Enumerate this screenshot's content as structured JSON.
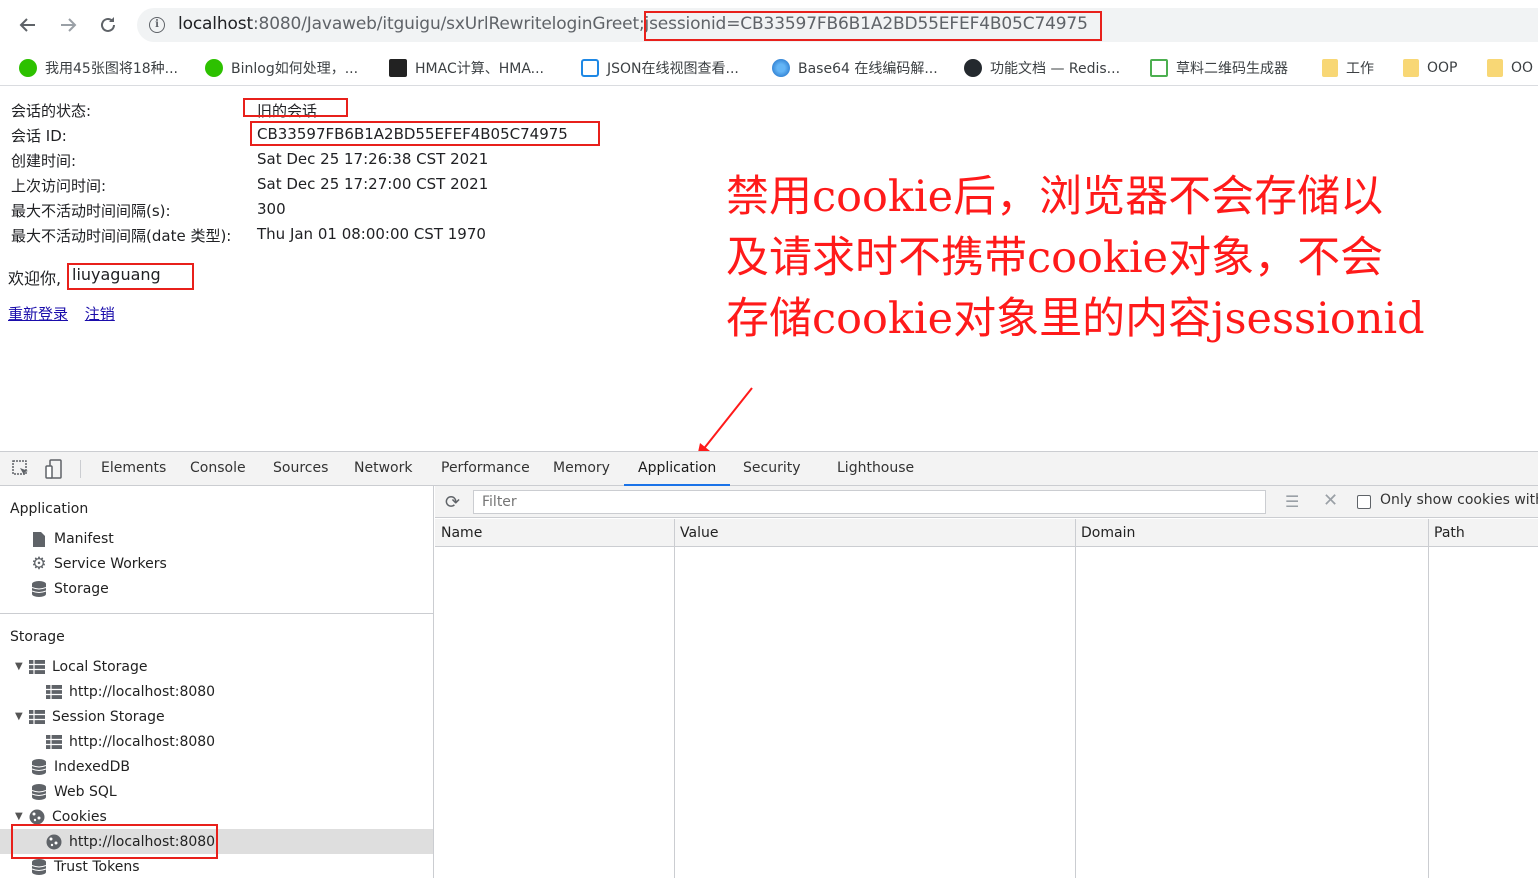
{
  "browser": {
    "url_host": "localhost",
    "url_rest": ":8080/Javaweb/itguigu/sxUrlRewriteloginGreet;jsessionid=CB33597FB6B1A2BD55EFEF4B05C74975",
    "bookmarks": [
      {
        "label": "我用45张图将18种...",
        "icon": "wechat-icon"
      },
      {
        "label": "Binlog如何处理，...",
        "icon": "wechat-icon"
      },
      {
        "label": "HMAC计算、HMA...",
        "icon": "hmac-icon"
      },
      {
        "label": "JSON在线视图查看...",
        "icon": "json-icon"
      },
      {
        "label": "Base64 在线编码解...",
        "icon": "base64-icon"
      },
      {
        "label": "功能文档 — Redis...",
        "icon": "github-icon"
      },
      {
        "label": "草料二维码生成器",
        "icon": "qrcode-icon"
      },
      {
        "label": "工作",
        "icon": "folder-icon"
      },
      {
        "label": "OOP",
        "icon": "folder-icon"
      },
      {
        "label": "OO",
        "icon": "folder-icon"
      }
    ]
  },
  "session_info": {
    "rows": [
      {
        "label": "会话的状态:",
        "value": "旧的会话"
      },
      {
        "label": "会话 ID:",
        "value": "CB33597FB6B1A2BD55EFEF4B05C74975"
      },
      {
        "label": "创建时间:",
        "value": "Sat Dec 25 17:26:38 CST 2021"
      },
      {
        "label": "上次访问时间:",
        "value": "Sat Dec 25 17:27:00 CST 2021"
      },
      {
        "label": "最大不活动时间间隔(s):",
        "value": "300"
      },
      {
        "label": "最大不活动时间间隔(date 类型):",
        "value": "Thu Jan 01 08:00:00 CST 1970"
      }
    ],
    "welcome_prefix": "欢迎你,",
    "username": "liuyaguang",
    "relogin_link": "重新登录",
    "logout_link": "注销"
  },
  "annotation": {
    "lines": [
      "禁用cookie后，浏览器不会存储以",
      "及请求时不携带cookie对象，不会",
      "存储cookie对象里的内容jsessionid"
    ],
    "color": "#ff1a1a"
  },
  "devtools": {
    "tabs": [
      "Elements",
      "Console",
      "Sources",
      "Network",
      "Performance",
      "Memory",
      "Application",
      "Security",
      "Lighthouse"
    ],
    "active_tab": "Application",
    "sidebar": {
      "application_title": "Application",
      "application_items": [
        "Manifest",
        "Service Workers",
        "Storage"
      ],
      "storage_title": "Storage",
      "local_storage": "Local Storage",
      "local_storage_origin": "http://localhost:8080",
      "session_storage": "Session Storage",
      "session_storage_origin": "http://localhost:8080",
      "indexeddb": "IndexedDB",
      "websql": "Web SQL",
      "cookies": "Cookies",
      "cookies_origin": "http://localhost:8080",
      "trust_tokens": "Trust Tokens"
    },
    "toolbar": {
      "filter_placeholder": "Filter",
      "only_show_cookies": "Only show cookies with"
    },
    "table": {
      "columns": [
        "Name",
        "Value",
        "Domain",
        "Path"
      ]
    },
    "accent_color": "#1a73e8"
  }
}
